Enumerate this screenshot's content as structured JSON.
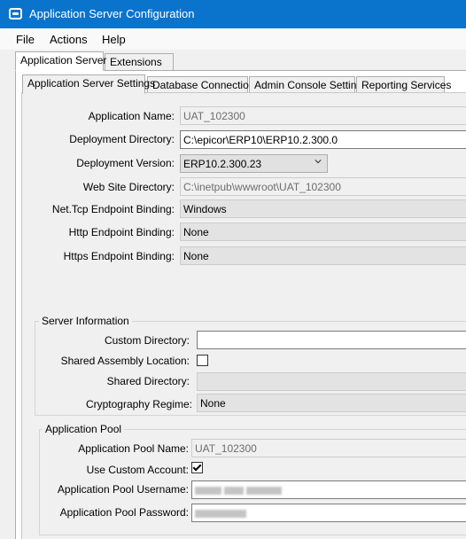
{
  "window": {
    "title": "Application Server Configuration",
    "icon": "app-window-icon",
    "accent": "#0a74cd"
  },
  "menu": {
    "items": [
      "File",
      "Actions",
      "Help"
    ]
  },
  "outer_tabs": [
    "Application Server",
    "Extensions"
  ],
  "inner_tabs": [
    "Application Server Settings",
    "Database Connection",
    "Admin Console Settings",
    "Reporting Services"
  ],
  "settings": {
    "app_name": {
      "label": "Application Name:",
      "value": "UAT_102300"
    },
    "deploy_dir": {
      "label": "Deployment Directory:",
      "value": "C:\\epicor\\ERP10\\ERP10.2.300.0"
    },
    "deploy_ver": {
      "label": "Deployment Version:",
      "value": "ERP10.2.300.23"
    },
    "web_dir": {
      "label": "Web Site Directory:",
      "value": "C:\\inetpub\\wwwroot\\UAT_102300"
    },
    "nettcp": {
      "label": "Net.Tcp Endpoint Binding:",
      "value": "Windows"
    },
    "http": {
      "label": "Http Endpoint Binding:",
      "value": "None"
    },
    "https": {
      "label": "Https Endpoint Binding:",
      "value": "None"
    }
  },
  "server_info": {
    "title": "Server Information",
    "custom_dir": {
      "label": "Custom Directory:",
      "value": ""
    },
    "shared_assembly": {
      "label": "Shared Assembly Location:",
      "checked": false
    },
    "shared_dir": {
      "label": "Shared Directory:",
      "value": ""
    },
    "crypto": {
      "label": "Cryptography Regime:",
      "value": "None"
    }
  },
  "app_pool": {
    "title": "Application Pool",
    "name": {
      "label": "Application Pool Name:",
      "value": "UAT_102300"
    },
    "custom_account": {
      "label": "Use Custom Account:",
      "checked": true
    },
    "username": {
      "label": "Application Pool Username:"
    },
    "password": {
      "label": "Application Pool Password:"
    }
  }
}
